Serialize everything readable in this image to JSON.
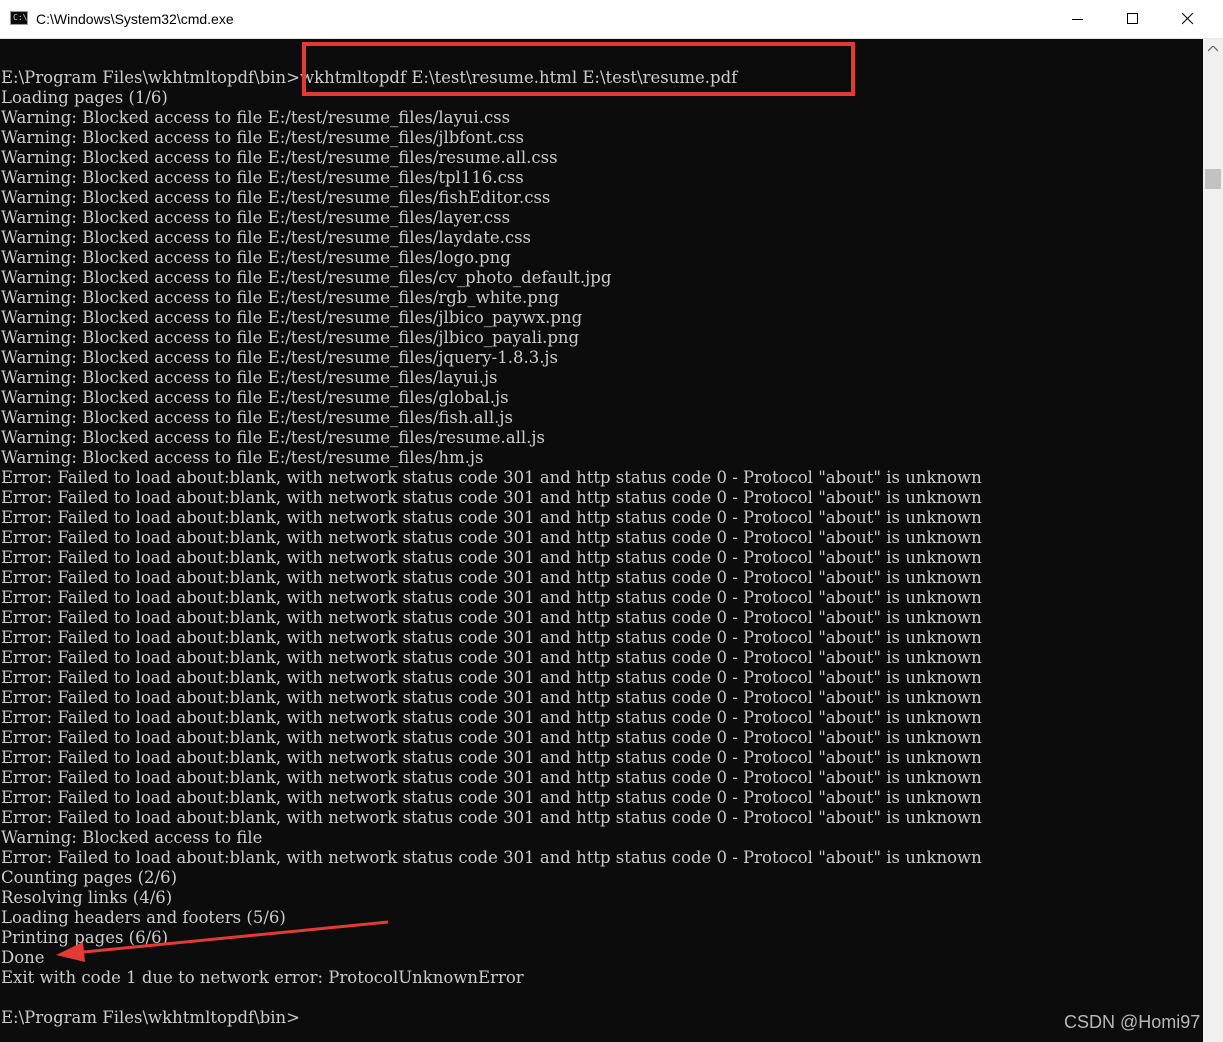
{
  "window": {
    "title": "C:\\Windows\\System32\\cmd.exe",
    "icon": "cmd-icon",
    "icon_text": "C:\\"
  },
  "console": {
    "lines": [
      "",
      "E:\\Program Files\\wkhtmltopdf\\bin>wkhtmltopdf E:\\test\\resume.html E:\\test\\resume.pdf",
      "Loading pages (1/6)",
      "Warning: Blocked access to file E:/test/resume_files/layui.css",
      "Warning: Blocked access to file E:/test/resume_files/jlbfont.css",
      "Warning: Blocked access to file E:/test/resume_files/resume.all.css",
      "Warning: Blocked access to file E:/test/resume_files/tpl116.css",
      "Warning: Blocked access to file E:/test/resume_files/fishEditor.css",
      "Warning: Blocked access to file E:/test/resume_files/layer.css",
      "Warning: Blocked access to file E:/test/resume_files/laydate.css",
      "Warning: Blocked access to file E:/test/resume_files/logo.png",
      "Warning: Blocked access to file E:/test/resume_files/cv_photo_default.jpg",
      "Warning: Blocked access to file E:/test/resume_files/rgb_white.png",
      "Warning: Blocked access to file E:/test/resume_files/jlbico_paywx.png",
      "Warning: Blocked access to file E:/test/resume_files/jlbico_payali.png",
      "Warning: Blocked access to file E:/test/resume_files/jquery-1.8.3.js",
      "Warning: Blocked access to file E:/test/resume_files/layui.js",
      "Warning: Blocked access to file E:/test/resume_files/global.js",
      "Warning: Blocked access to file E:/test/resume_files/fish.all.js",
      "Warning: Blocked access to file E:/test/resume_files/resume.all.js",
      "Warning: Blocked access to file E:/test/resume_files/hm.js",
      "Error: Failed to load about:blank, with network status code 301 and http status code 0 - Protocol \"about\" is unknown",
      "Error: Failed to load about:blank, with network status code 301 and http status code 0 - Protocol \"about\" is unknown",
      "Error: Failed to load about:blank, with network status code 301 and http status code 0 - Protocol \"about\" is unknown",
      "Error: Failed to load about:blank, with network status code 301 and http status code 0 - Protocol \"about\" is unknown",
      "Error: Failed to load about:blank, with network status code 301 and http status code 0 - Protocol \"about\" is unknown",
      "Error: Failed to load about:blank, with network status code 301 and http status code 0 - Protocol \"about\" is unknown",
      "Error: Failed to load about:blank, with network status code 301 and http status code 0 - Protocol \"about\" is unknown",
      "Error: Failed to load about:blank, with network status code 301 and http status code 0 - Protocol \"about\" is unknown",
      "Error: Failed to load about:blank, with network status code 301 and http status code 0 - Protocol \"about\" is unknown",
      "Error: Failed to load about:blank, with network status code 301 and http status code 0 - Protocol \"about\" is unknown",
      "Error: Failed to load about:blank, with network status code 301 and http status code 0 - Protocol \"about\" is unknown",
      "Error: Failed to load about:blank, with network status code 301 and http status code 0 - Protocol \"about\" is unknown",
      "Error: Failed to load about:blank, with network status code 301 and http status code 0 - Protocol \"about\" is unknown",
      "Error: Failed to load about:blank, with network status code 301 and http status code 0 - Protocol \"about\" is unknown",
      "Error: Failed to load about:blank, with network status code 301 and http status code 0 - Protocol \"about\" is unknown",
      "Error: Failed to load about:blank, with network status code 301 and http status code 0 - Protocol \"about\" is unknown",
      "Error: Failed to load about:blank, with network status code 301 and http status code 0 - Protocol \"about\" is unknown",
      "Error: Failed to load about:blank, with network status code 301 and http status code 0 - Protocol \"about\" is unknown",
      "Warning: Blocked access to file",
      "Error: Failed to load about:blank, with network status code 301 and http status code 0 - Protocol \"about\" is unknown",
      "Counting pages (2/6)",
      "Resolving links (4/6)",
      "Loading headers and footers (5/6)",
      "Printing pages (6/6)",
      "Done",
      "Exit with code 1 due to network error: ProtocolUnknownError",
      "",
      "E:\\Program Files\\wkhtmltopdf\\bin>"
    ]
  },
  "annotations": {
    "highlight_color": "#e53935",
    "watermark": "CSDN @Homi97"
  },
  "colors": {
    "console_bg": "#0c0c0c",
    "console_text": "#cccccc"
  }
}
